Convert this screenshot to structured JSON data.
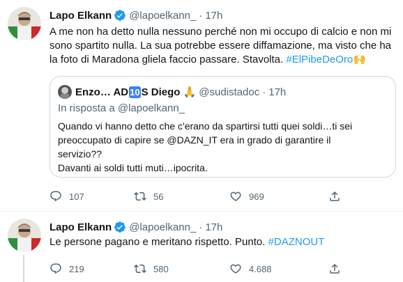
{
  "tweets": [
    {
      "name": "Lapo Elkann",
      "handle": "@lapoelkann_",
      "dot": "·",
      "time": "17h",
      "text": "A me non ha detto nulla nessuno perché non mi occupo di calcio e non mi sono spartito nulla. La sua potrebbe essere diffamazione, ma visto che ha la foto di Maradona gliela faccio passare. Stavolta.",
      "hashtag": "#ElPibeDeOro",
      "emoji": "🙌",
      "quote": {
        "name_prefix": "Enzo… AD",
        "name_badge": "10",
        "name_suffix": "S Diego",
        "name_emoji": "🙏",
        "handle": "@sudistadoc",
        "dot": "·",
        "time": "17h",
        "reply_to": "In risposta a @lapoelkann_",
        "text_lines": [
          "Quando vi hanno detto che c'erano da spartirsi tutti quei soldi…ti sei",
          "preoccupato di capire se @DAZN_IT era in grado di garantire il",
          "servizio??",
          "Davanti ai soldi tutti muti…ipocrita."
        ]
      },
      "stats": {
        "replies": "107",
        "retweets": "56",
        "likes": "969"
      }
    },
    {
      "name": "Lapo Elkann",
      "handle": "@lapoelkann_",
      "dot": "·",
      "time": "17h",
      "text": "Le persone pagano e meritano rispetto. Punto.",
      "hashtag": "#DAZNOUT",
      "stats": {
        "replies": "219",
        "retweets": "580",
        "likes": "4.688"
      }
    }
  ],
  "icons": {
    "verified": "verified-badge-icon",
    "reply": "reply-icon",
    "retweet": "retweet-icon",
    "like": "heart-icon",
    "share": "share-icon"
  },
  "colors": {
    "link": "#1d9bf0",
    "secondary": "#536471",
    "border": "#cfd9de"
  }
}
